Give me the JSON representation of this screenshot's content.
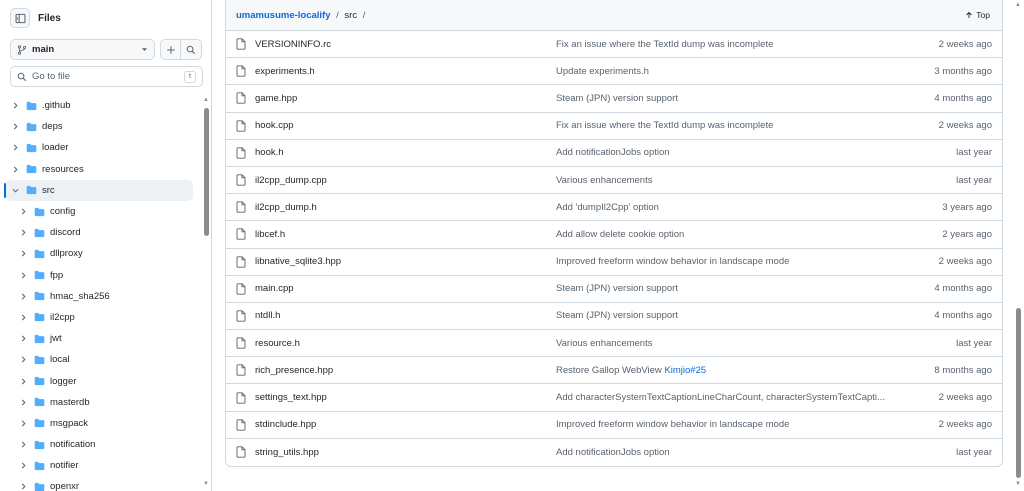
{
  "sidebar": {
    "title": "Files",
    "branch": "main",
    "search_placeholder": "Go to file",
    "search_shortcut": "t",
    "tree": [
      {
        "label": ".github",
        "level": 0,
        "expanded": false,
        "active": false
      },
      {
        "label": "deps",
        "level": 0,
        "expanded": false,
        "active": false
      },
      {
        "label": "loader",
        "level": 0,
        "expanded": false,
        "active": false
      },
      {
        "label": "resources",
        "level": 0,
        "expanded": false,
        "active": false
      },
      {
        "label": "src",
        "level": 0,
        "expanded": true,
        "active": true
      },
      {
        "label": "config",
        "level": 1,
        "expanded": false,
        "active": false
      },
      {
        "label": "discord",
        "level": 1,
        "expanded": false,
        "active": false
      },
      {
        "label": "dllproxy",
        "level": 1,
        "expanded": false,
        "active": false
      },
      {
        "label": "fpp",
        "level": 1,
        "expanded": false,
        "active": false
      },
      {
        "label": "hmac_sha256",
        "level": 1,
        "expanded": false,
        "active": false
      },
      {
        "label": "il2cpp",
        "level": 1,
        "expanded": false,
        "active": false
      },
      {
        "label": "jwt",
        "level": 1,
        "expanded": false,
        "active": false
      },
      {
        "label": "local",
        "level": 1,
        "expanded": false,
        "active": false
      },
      {
        "label": "logger",
        "level": 1,
        "expanded": false,
        "active": false
      },
      {
        "label": "masterdb",
        "level": 1,
        "expanded": false,
        "active": false
      },
      {
        "label": "msgpack",
        "level": 1,
        "expanded": false,
        "active": false
      },
      {
        "label": "notification",
        "level": 1,
        "expanded": false,
        "active": false
      },
      {
        "label": "notifier",
        "level": 1,
        "expanded": false,
        "active": false
      },
      {
        "label": "openxr",
        "level": 1,
        "expanded": false,
        "active": false
      }
    ]
  },
  "breadcrumb": {
    "repo": "umamusume-localify",
    "sep1": "/",
    "dir": "src",
    "sep2": "/"
  },
  "top_label": "Top",
  "files": [
    {
      "name": "VERSIONINFO.rc",
      "message": "Fix an issue where the TextId dump was incomplete",
      "link": "",
      "date": "2 weeks ago"
    },
    {
      "name": "experiments.h",
      "message": "Update experiments.h",
      "link": "",
      "date": "3 months ago"
    },
    {
      "name": "game.hpp",
      "message": "Steam (JPN) version support",
      "link": "",
      "date": "4 months ago"
    },
    {
      "name": "hook.cpp",
      "message": "Fix an issue where the TextId dump was incomplete",
      "link": "",
      "date": "2 weeks ago"
    },
    {
      "name": "hook.h",
      "message": "Add notificationJobs option",
      "link": "",
      "date": "last year"
    },
    {
      "name": "il2cpp_dump.cpp",
      "message": "Various enhancements",
      "link": "",
      "date": "last year"
    },
    {
      "name": "il2cpp_dump.h",
      "message": "Add 'dumpIl2Cpp' option",
      "link": "",
      "date": "3 years ago"
    },
    {
      "name": "libcef.h",
      "message": "Add allow delete cookie option",
      "link": "",
      "date": "2 years ago"
    },
    {
      "name": "libnative_sqlite3.hpp",
      "message": "Improved freeform window behavior in landscape mode",
      "link": "",
      "date": "2 weeks ago"
    },
    {
      "name": "main.cpp",
      "message": "Steam (JPN) version support",
      "link": "",
      "date": "4 months ago"
    },
    {
      "name": "ntdll.h",
      "message": "Steam (JPN) version support",
      "link": "",
      "date": "4 months ago"
    },
    {
      "name": "resource.h",
      "message": "Various enhancements",
      "link": "",
      "date": "last year"
    },
    {
      "name": "rich_presence.hpp",
      "message": "Restore Gallop WebView ",
      "link": "Kimjio#25",
      "date": "8 months ago"
    },
    {
      "name": "settings_text.hpp",
      "message": "Add characterSystemTextCaptionLineCharCount, characterSystemTextCapti...",
      "link": "",
      "date": "2 weeks ago"
    },
    {
      "name": "stdinclude.hpp",
      "message": "Improved freeform window behavior in landscape mode",
      "link": "",
      "date": "2 weeks ago"
    },
    {
      "name": "string_utils.hpp",
      "message": "Add notificationJobs option",
      "link": "",
      "date": "last year"
    }
  ],
  "colors": {
    "accent": "#0969da",
    "folder": "#54aeff",
    "muted": "#59636e",
    "border": "#d1d9e0"
  }
}
